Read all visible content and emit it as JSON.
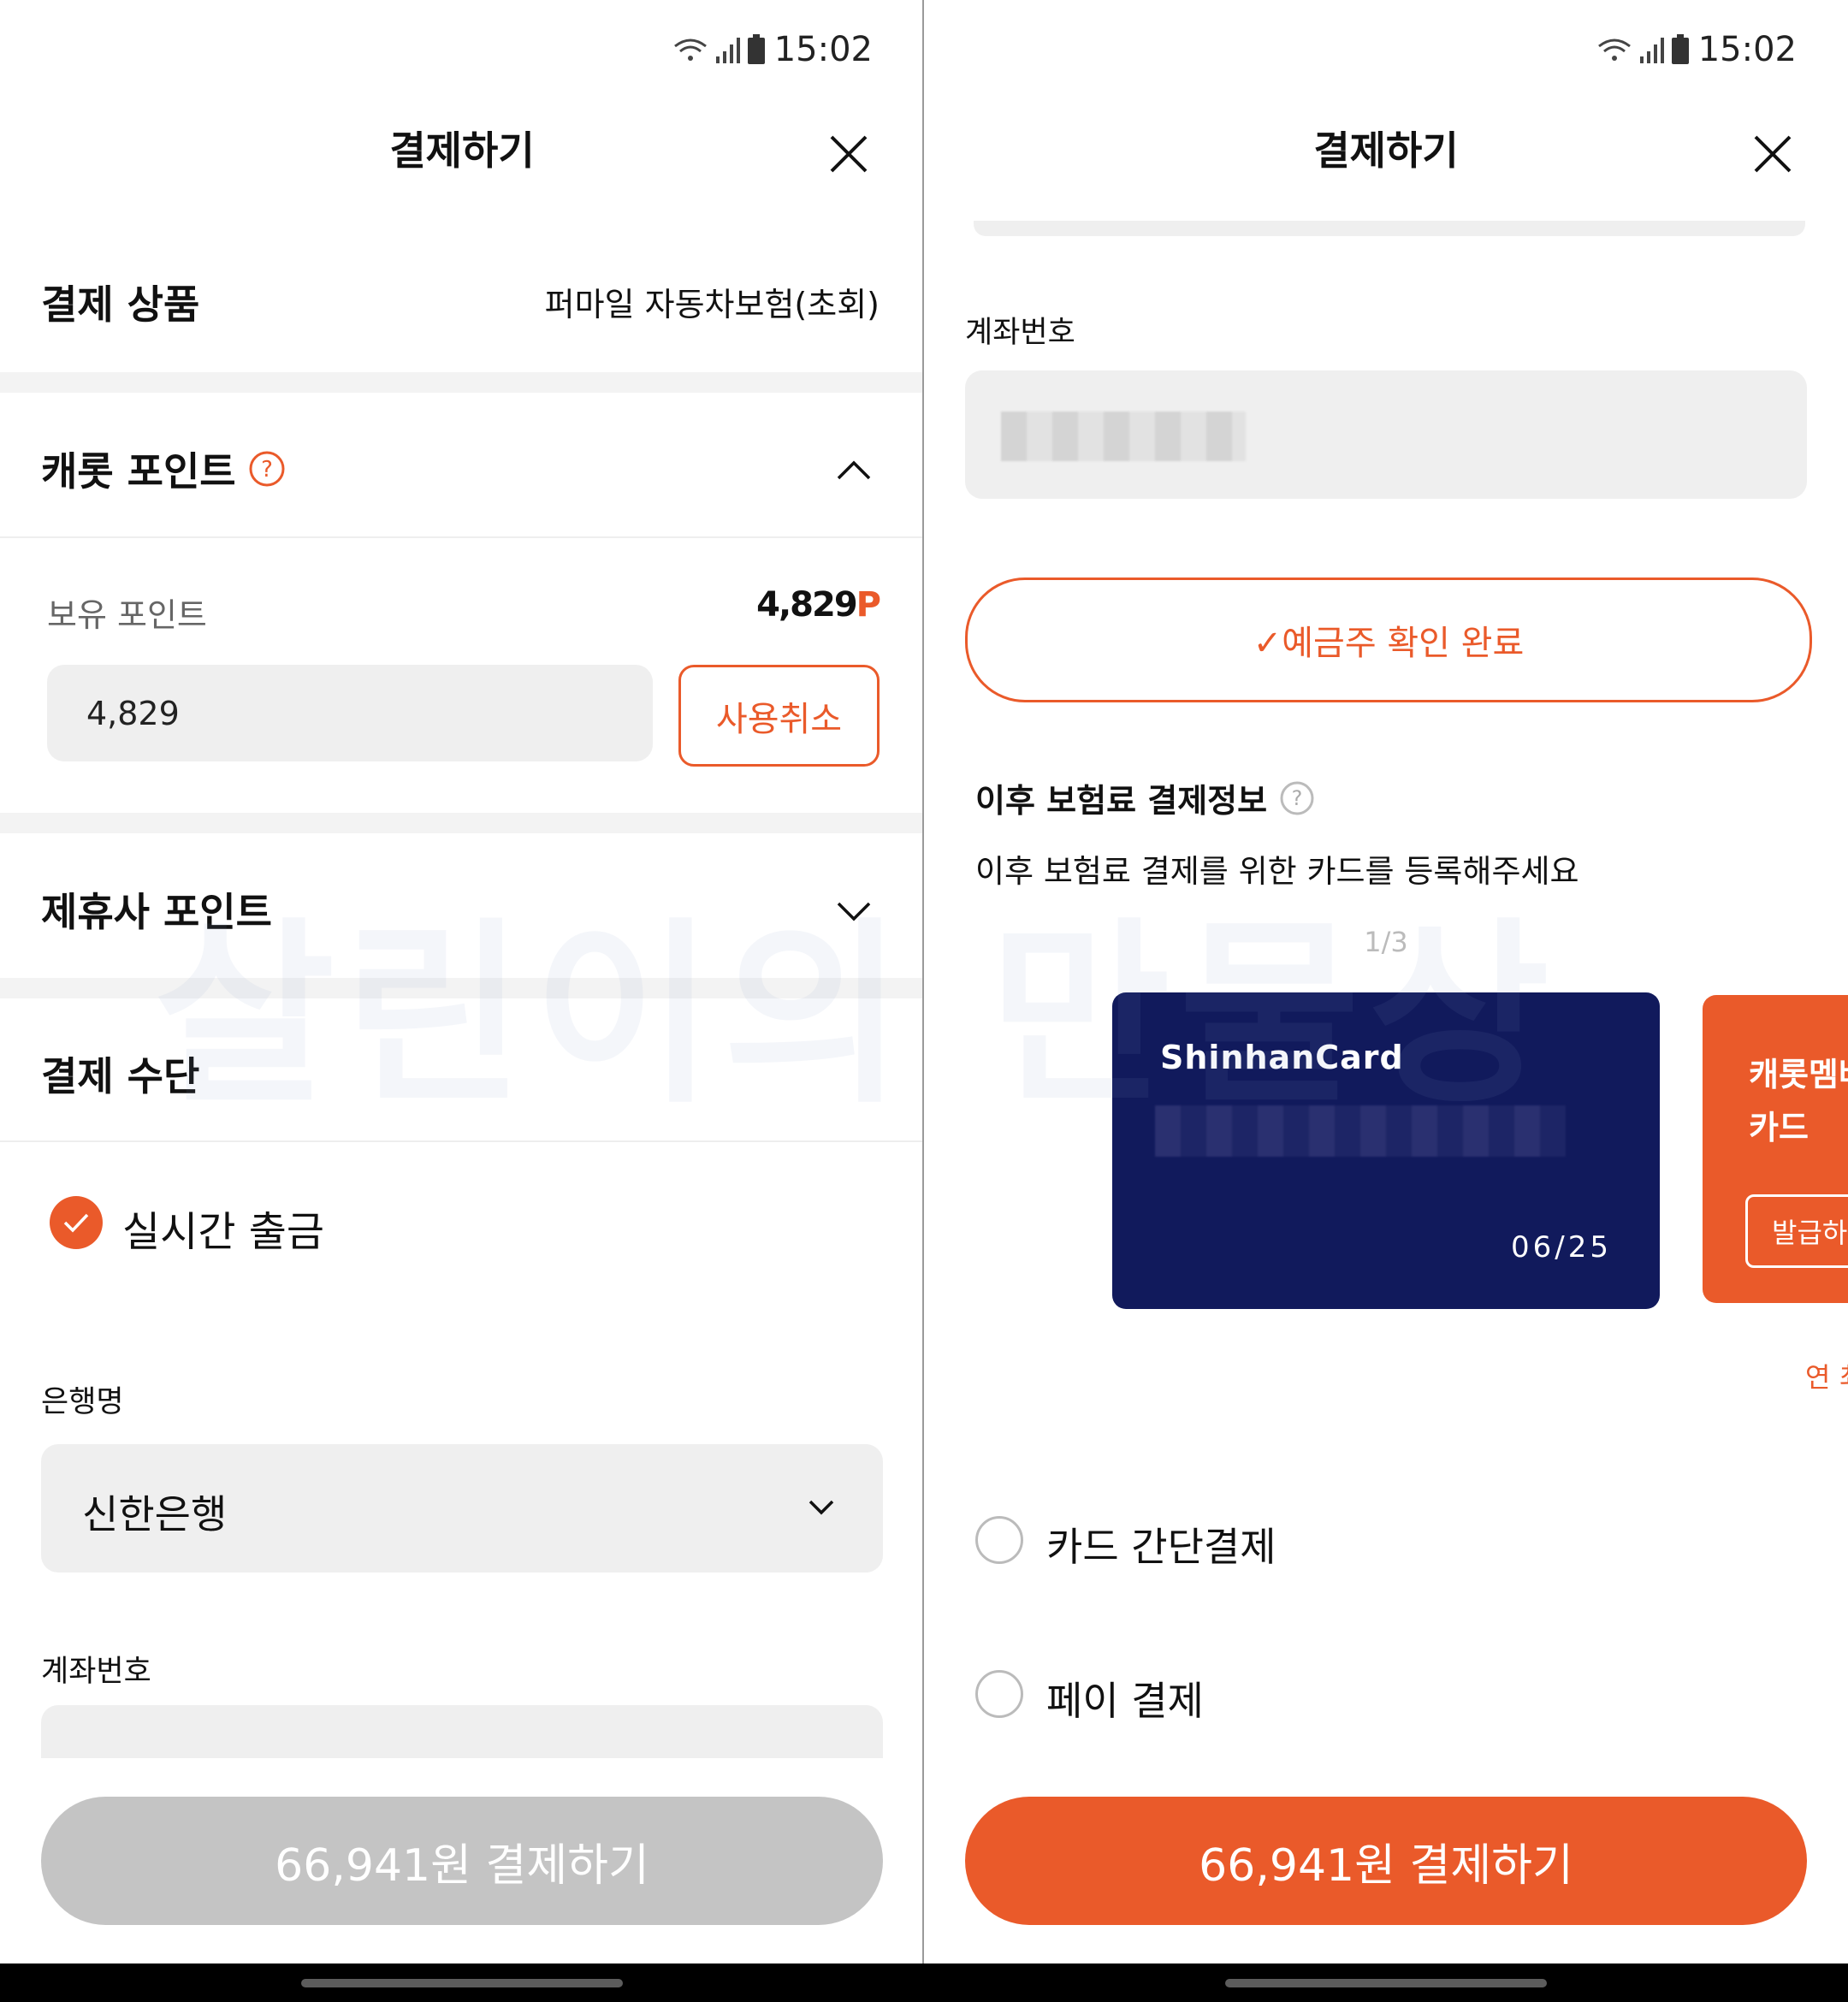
{
  "status_bar": {
    "time": "15:02"
  },
  "left": {
    "title": "결제하기",
    "product_label": "결제 상품",
    "product_value": "퍼마일 자동차보험(초회)",
    "point_section_title": "캐롯 포인트",
    "owned_points_label": "보유 포인트",
    "owned_points_value": "4,829",
    "owned_points_unit": "P",
    "points_input_value": "4,829",
    "cancel_use_button": "사용취소",
    "partner_points_title": "제휴사 포인트",
    "payment_method_title": "결제 수단",
    "realtime_withdrawal_label": "실시간 출금",
    "bank_label": "은행명",
    "bank_value": "신한은행",
    "account_label": "계좌번호",
    "pay_button": "66,941원 결제하기"
  },
  "right": {
    "title": "결제하기",
    "account_label": "계좌번호",
    "depositor_confirm_button": "✓예금주 확인 완료",
    "future_payment_title": "이후 보험료 결제정보",
    "future_payment_desc": "이후 보험료 결제를 위한 카드를 등록해주세요",
    "card_pager": "1/3",
    "card1": {
      "brand": "ShinhanCard",
      "expiry": "06/25"
    },
    "card2": {
      "title_line1": "캐롯멤버",
      "title_line2": "카드",
      "button": "발급하기"
    },
    "card2_caption": "연 최",
    "option_card_easy_pay": "카드 간단결제",
    "option_pay": "페이 결제",
    "pay_button": "66,941원 결제하기"
  },
  "watermark": "살린이의 만물상",
  "colors": {
    "accent": "#ea5a2a",
    "card_navy": "#111a5c",
    "disabled_button": "#c4c4c4"
  }
}
